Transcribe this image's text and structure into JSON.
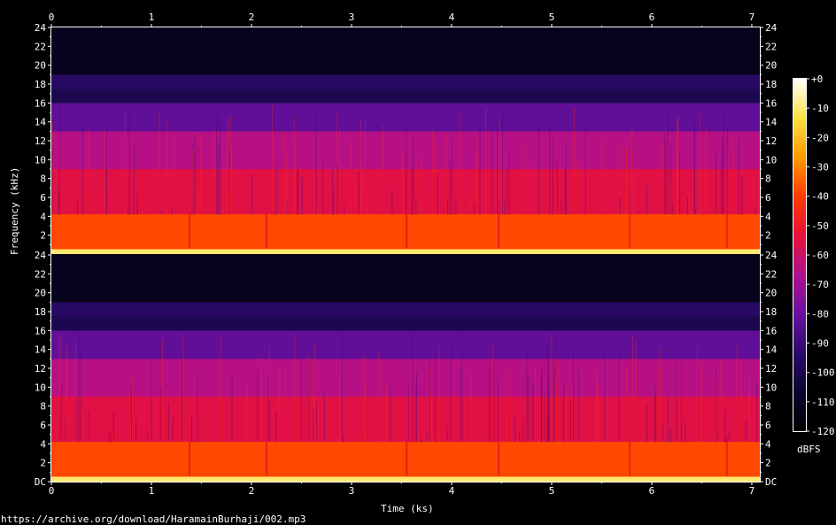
{
  "chart_data": {
    "type": "heatmap",
    "title": "",
    "xlabel": "Time (ks)",
    "ylabel": "Frequency (kHz)",
    "x_ticks": [
      "0",
      "1",
      "2",
      "3",
      "4",
      "5",
      "6",
      "7"
    ],
    "xlim": [
      0,
      7.08
    ],
    "channels": [
      {
        "name": "channel-1",
        "y_ticks": [
          "2",
          "4",
          "6",
          "8",
          "10",
          "12",
          "14",
          "16",
          "18",
          "20",
          "22",
          "24"
        ],
        "ylim": [
          0,
          24
        ]
      },
      {
        "name": "channel-2",
        "y_ticks": [
          "DC",
          "2",
          "4",
          "6",
          "8",
          "10",
          "12",
          "14",
          "16",
          "18",
          "20",
          "22",
          "24"
        ],
        "ylim": [
          0,
          24
        ]
      }
    ],
    "frequency_bands_dbfs": [
      {
        "from_khz": 0.0,
        "to_khz": 0.5,
        "level": -10
      },
      {
        "from_khz": 0.5,
        "to_khz": 4.2,
        "level": -38
      },
      {
        "from_khz": 4.2,
        "to_khz": 9.0,
        "level": -55
      },
      {
        "from_khz": 9.0,
        "to_khz": 13.0,
        "level": -65
      },
      {
        "from_khz": 13.0,
        "to_khz": 16.0,
        "level": -82
      },
      {
        "from_khz": 16.0,
        "to_khz": 17.5,
        "level": -100
      },
      {
        "from_khz": 17.5,
        "to_khz": 19.0,
        "level": -95
      },
      {
        "from_khz": 19.0,
        "to_khz": 24.0,
        "level": -112
      }
    ],
    "colorbar": {
      "unit": "dBFS",
      "ticks": [
        "+0",
        "-10",
        "-20",
        "-30",
        "-40",
        "-50",
        "-60",
        "-70",
        "-80",
        "-90",
        "-100",
        "-110",
        "-120"
      ],
      "range": [
        -120,
        0
      ],
      "colors": [
        "#000000",
        "#0b0530",
        "#2b0a6b",
        "#6a0fa0",
        "#b0108f",
        "#e8103a",
        "#ff3a00",
        "#ff9a00",
        "#ffe040",
        "#ffffff"
      ]
    }
  },
  "footer": {
    "source_url": "https://archive.org/download/HaramainBurhaji/002.mp3"
  }
}
